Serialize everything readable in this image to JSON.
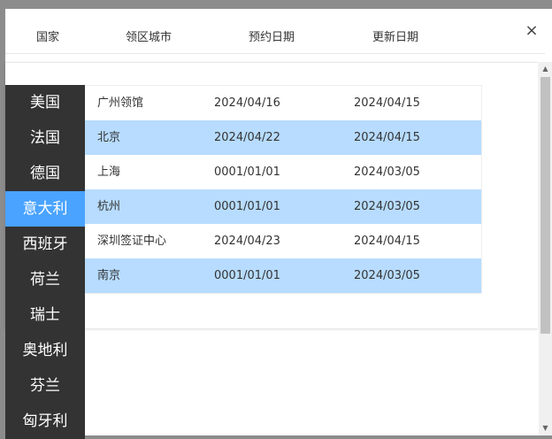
{
  "header": {
    "columns": [
      "国家",
      "领区城市",
      "预约日期",
      "更新日期"
    ],
    "close_label": "×"
  },
  "countries": [
    {
      "label": "美国",
      "active": false
    },
    {
      "label": "法国",
      "active": false
    },
    {
      "label": "德国",
      "active": false
    },
    {
      "label": "意大利",
      "active": true
    },
    {
      "label": "西班牙",
      "active": false
    },
    {
      "label": "荷兰",
      "active": false
    },
    {
      "label": "瑞士",
      "active": false
    },
    {
      "label": "奥地利",
      "active": false
    },
    {
      "label": "芬兰",
      "active": false
    },
    {
      "label": "匈牙利",
      "active": false
    }
  ],
  "rows": [
    {
      "city": "广州领馆",
      "appointment": "2024/04/16",
      "updated": "2024/04/15"
    },
    {
      "city": "北京",
      "appointment": "2024/04/22",
      "updated": "2024/04/15"
    },
    {
      "city": "上海",
      "appointment": "0001/01/01",
      "updated": "2024/03/05"
    },
    {
      "city": "杭州",
      "appointment": "0001/01/01",
      "updated": "2024/03/05"
    },
    {
      "city": "深圳签证中心",
      "appointment": "2024/04/23",
      "updated": "2024/04/15"
    },
    {
      "city": "南京",
      "appointment": "0001/01/01",
      "updated": "2024/03/05"
    }
  ],
  "colors": {
    "overlay": "#8c8c8c",
    "sidebar": "#333333",
    "active": "#4aa3ff",
    "row_highlight": "#b7dcff"
  },
  "icons": {
    "close": "close-icon",
    "scroll_up": "triangle-up-icon",
    "scroll_down": "triangle-down-icon"
  }
}
